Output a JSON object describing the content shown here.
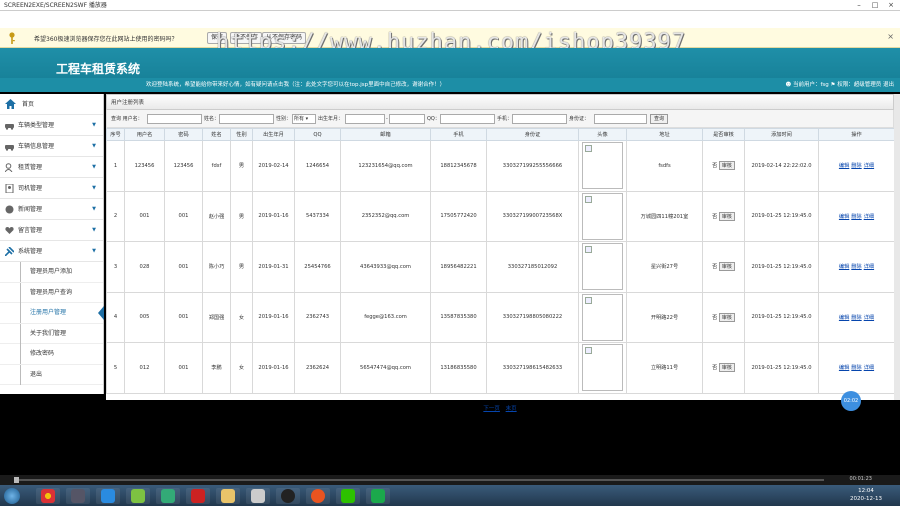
{
  "window": {
    "title": "SCREEN2EXE/SCREEN2SWF 播放器",
    "controls": [
      "–",
      "□",
      "×"
    ]
  },
  "password_bar": {
    "message": "希望360极速浏览器保存您在此网站上使用的密码吗？",
    "save_label": "保存",
    "notnow_label": "暂不保存",
    "never_label": "从不保存密码",
    "close_label": "×"
  },
  "watermark": "https://www.huzhan.com/ishop39397",
  "header": {
    "title": "工程车租赁系统",
    "welcome": "欢迎登陆系统，希望能给你带来好心情，如有疑问请点击我（注：此处文字您可以在top.jsp里面中自己修改，谢谢合作！）",
    "current_user_label": "当前用户：fsg",
    "role_label": "权限：超级管理员",
    "logout_label": "退出"
  },
  "sidebar": {
    "home": "首页",
    "items": [
      {
        "label": "车辆类型管理",
        "icon": "car-type-icon"
      },
      {
        "label": "车辆信息管理",
        "icon": "car-info-icon"
      },
      {
        "label": "租赁管理",
        "icon": "rent-icon"
      },
      {
        "label": "司机管理",
        "icon": "driver-icon"
      },
      {
        "label": "新闻管理",
        "icon": "news-icon"
      },
      {
        "label": "留言管理",
        "icon": "message-icon"
      },
      {
        "label": "系统管理",
        "icon": "system-icon"
      }
    ],
    "sub_items": [
      {
        "label": "管理员用户添加"
      },
      {
        "label": "管理员用户查询"
      },
      {
        "label": "注册用户管理"
      },
      {
        "label": "关于我们管理"
      },
      {
        "label": "修改密码"
      },
      {
        "label": "退出"
      }
    ]
  },
  "panel": {
    "title": "用户注册列表"
  },
  "query": {
    "username_label": "查询 用户名：",
    "name_label": "姓名：",
    "gender_label": "性别：",
    "gender_value": "所有",
    "birth_label": "出生年月：",
    "dash": "-",
    "qq_label": "QQ：",
    "phone_label": "手机：",
    "idcard_label": "身份证：",
    "search_label": "查询"
  },
  "table": {
    "headers": [
      "序号",
      "用户名",
      "密码",
      "姓名",
      "性别",
      "出生年月",
      "QQ",
      "邮箱",
      "手机",
      "身份证",
      "头像",
      "地址",
      "是否审核",
      "添加时间",
      "操作"
    ],
    "rows": [
      {
        "no": "1",
        "username": "123456",
        "password": "123456",
        "name": "fdsf",
        "gender": "男",
        "birth": "2019-02-14",
        "qq": "1246654",
        "email": "123231654@qq.com",
        "phone": "18812345678",
        "idcard": "330327199255556666",
        "address": "fsdfs",
        "audit": "否",
        "added": "2019-02-14 22:22:02.0"
      },
      {
        "no": "2",
        "username": "001",
        "password": "001",
        "name": "赵小强",
        "gender": "男",
        "birth": "2019-01-16",
        "qq": "5437334",
        "email": "2352352@qq.com",
        "phone": "17505772420",
        "idcard": "33032719900723568X",
        "address": "万城园四11幢201室",
        "audit": "否",
        "added": "2019-01-25 12:19:45.0"
      },
      {
        "no": "3",
        "username": "028",
        "password": "001",
        "name": "陈小巧",
        "gender": "男",
        "birth": "2019-01-31",
        "qq": "25454766",
        "email": "43643933@qq.com",
        "phone": "18956482221",
        "idcard": "330327185012092",
        "address": "星兴街27号",
        "audit": "否",
        "added": "2019-01-25 12:19:45.0"
      },
      {
        "no": "4",
        "username": "005",
        "password": "001",
        "name": "郑国强",
        "gender": "女",
        "birth": "2019-01-16",
        "qq": "2362743",
        "email": "fegge@163.com",
        "phone": "13587835380",
        "idcard": "330327198805080222",
        "address": "开明路22号",
        "audit": "否",
        "added": "2019-01-25 12:19:45.0"
      },
      {
        "no": "5",
        "username": "012",
        "password": "001",
        "name": "李鹏",
        "gender": "女",
        "birth": "2019-01-16",
        "qq": "2362624",
        "email": "56547474@qq.com",
        "phone": "13186835580",
        "idcard": "330327198615482633",
        "address": "立明路11号",
        "audit": "否",
        "added": "2019-01-25 12:19:45.0"
      }
    ],
    "audit_btn": "审核",
    "edit": "编辑",
    "delete": "删除",
    "detail": "详细"
  },
  "pager": {
    "next": "下一页",
    "last": "末页"
  },
  "float_badge": "02:02",
  "player": {
    "time": "00:01:23"
  },
  "taskbar": {
    "time": "12:04",
    "date": "2020-12-13"
  }
}
